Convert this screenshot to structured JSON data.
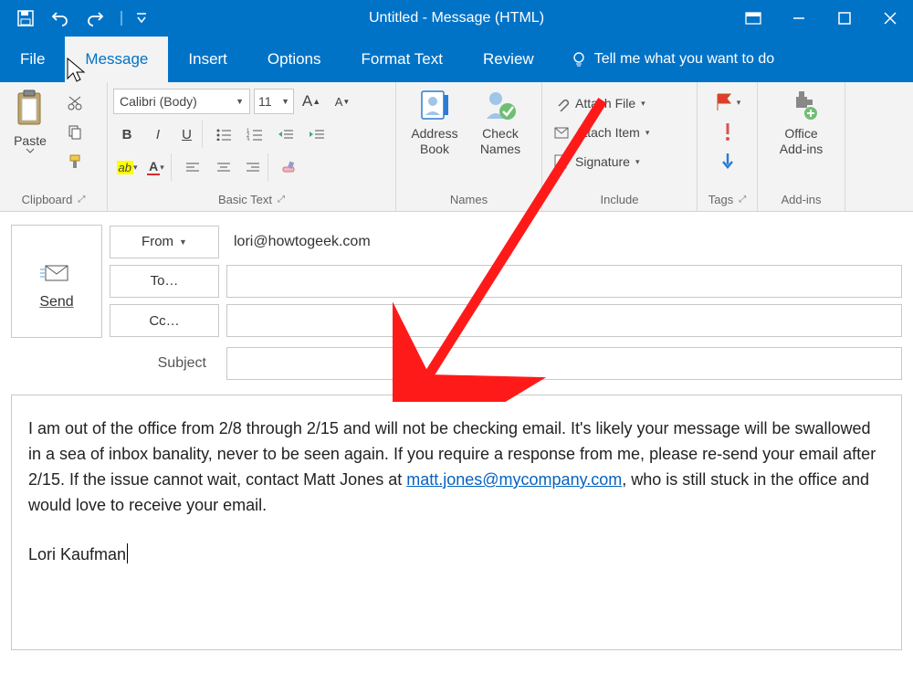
{
  "titlebar": {
    "title": "Untitled  -  Message (HTML)"
  },
  "tabs": {
    "file": "File",
    "message": "Message",
    "insert": "Insert",
    "options": "Options",
    "format_text": "Format Text",
    "review": "Review",
    "tell_me": "Tell me what you want to do"
  },
  "ribbon": {
    "clipboard": {
      "paste": "Paste",
      "label": "Clipboard"
    },
    "basic_text": {
      "font_name": "Calibri (Body)",
      "font_size": "11",
      "label": "Basic Text"
    },
    "names": {
      "address_book": "Address\nBook",
      "check_names": "Check\nNames",
      "label": "Names"
    },
    "include": {
      "attach_file": "Attach File",
      "attach_item": "Attach Item",
      "signature": "Signature",
      "label": "Include"
    },
    "tags": {
      "label": "Tags"
    },
    "addins": {
      "office_addins": "Office\nAdd-ins",
      "label": "Add-ins"
    }
  },
  "compose": {
    "send": "Send",
    "from_label": "From",
    "from_value": "lori@howtogeek.com",
    "to_label": "To…",
    "cc_label": "Cc…",
    "subject_label": "Subject"
  },
  "body": {
    "p1a": "I am out of the office from 2/8 through 2/15 and will not be checking email. It's likely your message will be swallowed in a sea of inbox banality, never to be seen again. If you require a response from me, please re-send your email after 2/15. If the issue cannot wait, contact Matt Jones at ",
    "link": "matt.jones@mycompany.com",
    "p1b": ", who is still stuck in the office and would love to receive your email.",
    "sig": "Lori Kaufman"
  }
}
